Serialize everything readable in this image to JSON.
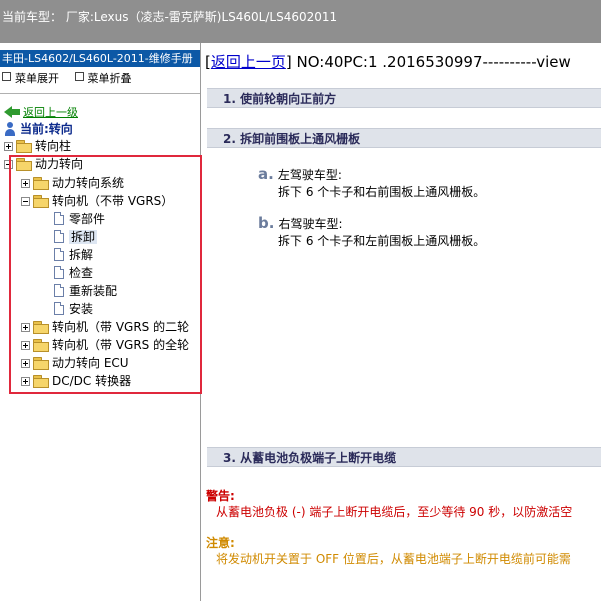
{
  "title_bar": {
    "text": "当前车型： 厂家:Lexus（凌志-雷克萨斯)LS460L/LS4602011"
  },
  "left_panel": {
    "header": "丰田-LS4602/LS460L-2011-维修手册",
    "toolbar": {
      "expand": "菜单展开",
      "collapse": "菜单折叠"
    },
    "back_link": "返回上一级",
    "current_label": "当前:转向",
    "tree": {
      "steering_column": "转向柱",
      "power_steering": "动力转向",
      "power_steering_system": "动力转向系统",
      "gear_no_vgrs": "转向机（不带 VGRS）",
      "gear_no_vgrs_children": [
        "零部件",
        "拆卸",
        "拆解",
        "检查",
        "重新装配",
        "安装"
      ],
      "gear_vgrs_2": "转向机（带 VGRS 的二轮",
      "gear_vgrs_all": "转向机（带 VGRS 的全轮",
      "ecu": "动力转向 ECU",
      "dcdc": "DC/DC 转换器"
    }
  },
  "right_panel": {
    "back_link": "返回上一页",
    "doc_id": "NO:40PC:1 .2016530997----------view",
    "steps": [
      {
        "label": "1. 使前轮朝向正前方"
      },
      {
        "label": "2. 拆卸前围板上通风栅板"
      },
      {
        "label": "3. 从蓄电池负极端子上断开电缆"
      }
    ],
    "substeps": [
      {
        "letter": "a.",
        "title": "左驾驶车型:",
        "text": "拆下 6 个卡子和右前围板上通风栅板。"
      },
      {
        "letter": "b.",
        "title": "右驾驶车型:",
        "text": "拆下 6 个卡子和左前围板上通风栅板。"
      }
    ],
    "warning": {
      "title": "警告:",
      "text": "从蓄电池负极 (-) 端子上断开电缆后，至少等待 90 秒，以防激活空"
    },
    "note": {
      "title": "注意:",
      "text": "将发动机开关置于 OFF 位置后，从蓄电池端子上断开电缆前可能需"
    }
  },
  "colors": {
    "title_bar_bg": "#8f8f8f",
    "header_bg": "#0c58a6",
    "highlight_box": "#e0283c",
    "warning": "#cc0000",
    "note": "#d08a00"
  }
}
